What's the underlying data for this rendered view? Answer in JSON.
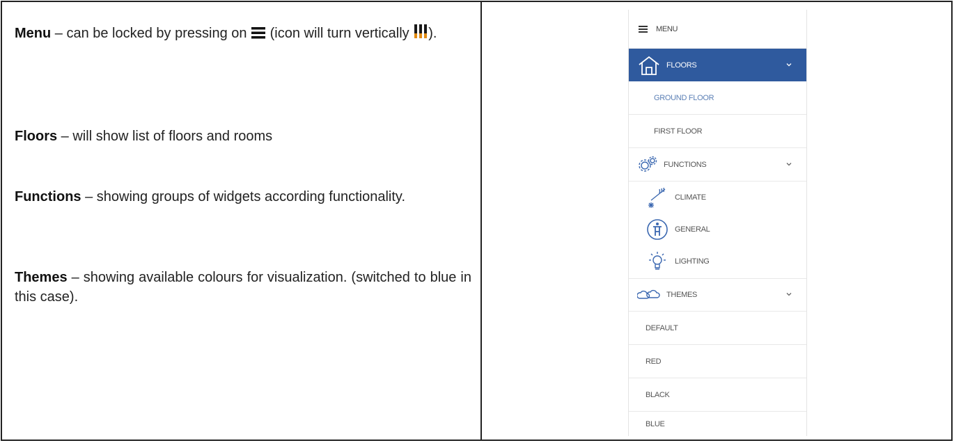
{
  "left": {
    "menu": {
      "title": "Menu",
      "text_before": " – can be locked by pressing on ",
      "text_middle": " (icon will turn vertically ",
      "text_after": ")."
    },
    "floors": {
      "title": "Floors",
      "text": " – will show list of floors and rooms"
    },
    "functions": {
      "title": "Functions",
      "text": " – showing groups of widgets according functionality."
    },
    "themes": {
      "title": "Themes",
      "text": " – showing available colours for visualization. (switched to blue in this case)."
    }
  },
  "menu_panel": {
    "header": {
      "icon": "hamburger-icon",
      "label": "MENU"
    },
    "floors": {
      "icon": "house-icon",
      "label": "FLOORS",
      "items": [
        "GROUND FLOOR",
        "FIRST FLOOR"
      ]
    },
    "functions": {
      "icon": "gear-icon",
      "label": "FUNCTIONS",
      "items": [
        {
          "icon": "climate-icon",
          "label": "CLIMATE"
        },
        {
          "icon": "general-icon",
          "label": "GENERAL"
        },
        {
          "icon": "lightbulb-icon",
          "label": "LIGHTING"
        }
      ]
    },
    "themes": {
      "icon": "clouds-icon",
      "label": "THEMES",
      "items": [
        "DEFAULT",
        "RED",
        "BLACK",
        "BLUE"
      ]
    }
  },
  "colors": {
    "accent_blue": "#2f5a9e",
    "icon_blue": "#3a67b0",
    "lock_icon_orange": "#e08a12"
  }
}
